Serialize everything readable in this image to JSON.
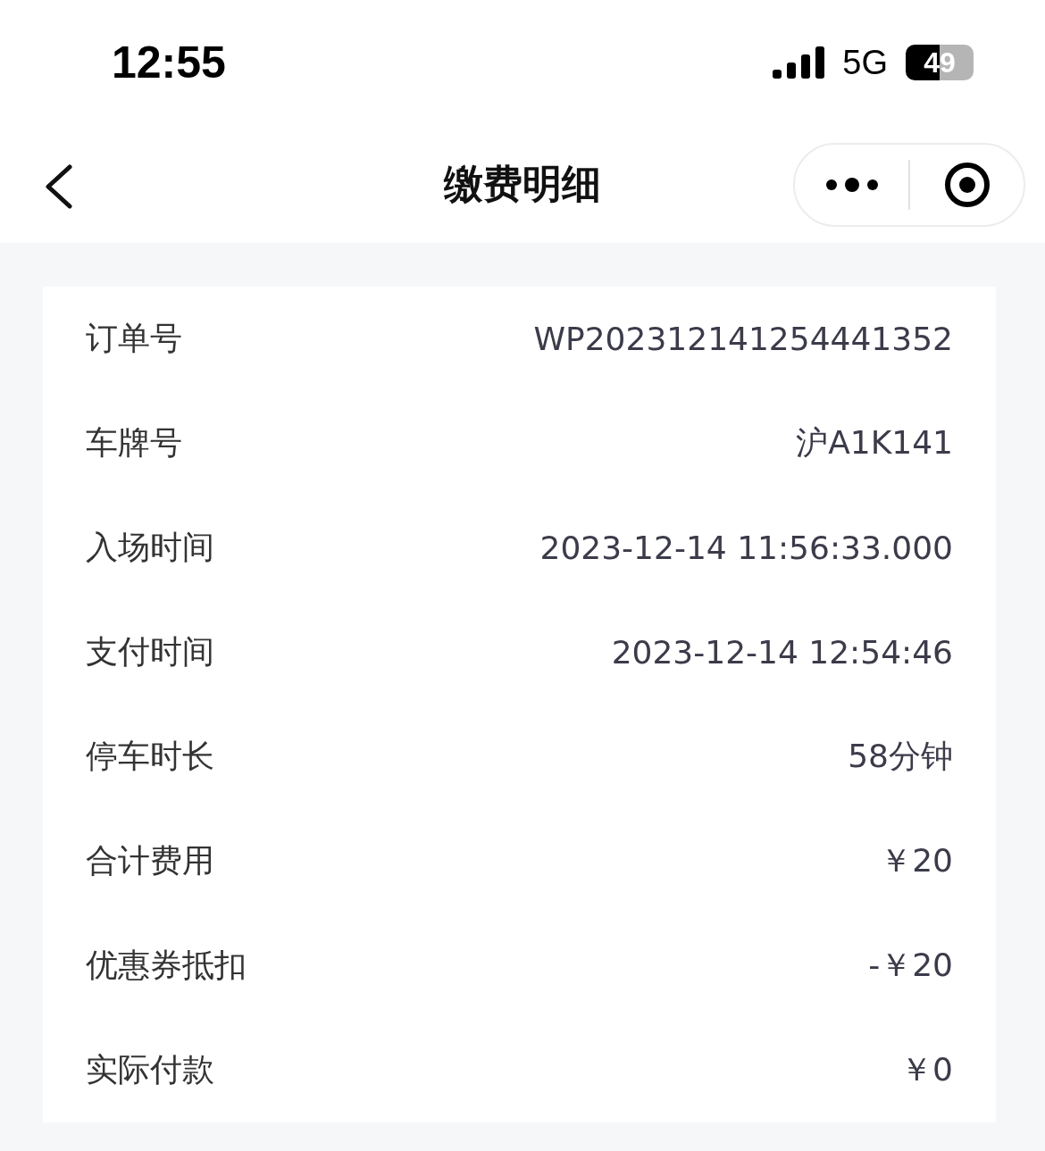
{
  "status_bar": {
    "time": "12:55",
    "network": "5G",
    "battery": "49"
  },
  "nav": {
    "title": "缴费明细"
  },
  "details": [
    {
      "label": "订单号",
      "value": "WP202312141254441352"
    },
    {
      "label": "车牌号",
      "value": "沪A1K141"
    },
    {
      "label": "入场时间",
      "value": "2023-12-14 11:56:33.000"
    },
    {
      "label": "支付时间",
      "value": "2023-12-14 12:54:46"
    },
    {
      "label": "停车时长",
      "value": "58分钟"
    },
    {
      "label": "合计费用",
      "value": "￥20"
    },
    {
      "label": "优惠券抵扣",
      "value": "-￥20"
    },
    {
      "label": "实际付款",
      "value": "￥0"
    }
  ]
}
